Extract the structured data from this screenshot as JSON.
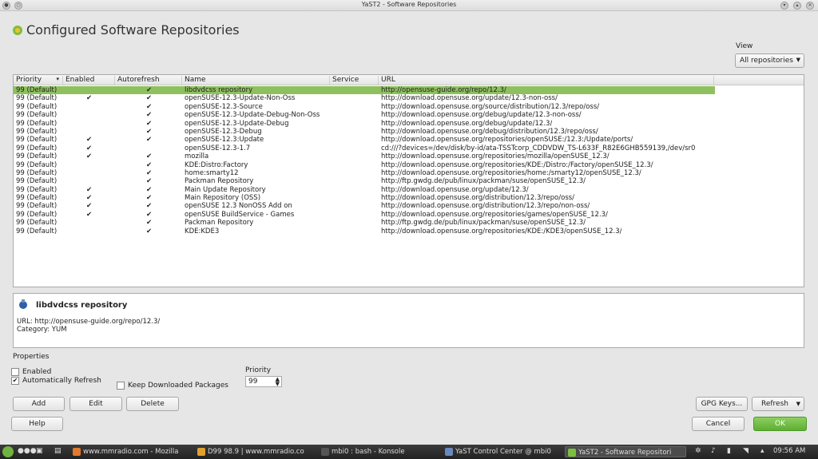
{
  "window": {
    "title": "YaST2 - Software Repositories"
  },
  "header": {
    "title": "Configured Software Repositories"
  },
  "view": {
    "label": "View",
    "selected": "All repositories"
  },
  "table": {
    "columns": [
      "Priority",
      "Enabled",
      "Autorefresh",
      "Name",
      "Service",
      "URL"
    ],
    "rows": [
      {
        "priority": "99 (Default)",
        "enabled": "",
        "autorefresh": "✔",
        "name": "libdvdcss repository",
        "service": "",
        "url": "http://opensuse-guide.org/repo/12.3/"
      },
      {
        "priority": "99 (Default)",
        "enabled": "✔",
        "autorefresh": "✔",
        "name": "openSUSE-12.3-Update-Non-Oss",
        "service": "",
        "url": "http://download.opensuse.org/update/12.3-non-oss/"
      },
      {
        "priority": "99 (Default)",
        "enabled": "",
        "autorefresh": "✔",
        "name": "openSUSE-12.3-Source",
        "service": "",
        "url": "http://download.opensuse.org/source/distribution/12.3/repo/oss/"
      },
      {
        "priority": "99 (Default)",
        "enabled": "",
        "autorefresh": "✔",
        "name": "openSUSE-12.3-Update-Debug-Non-Oss",
        "service": "",
        "url": "http://download.opensuse.org/debug/update/12.3-non-oss/"
      },
      {
        "priority": "99 (Default)",
        "enabled": "",
        "autorefresh": "✔",
        "name": "openSUSE-12.3-Update-Debug",
        "service": "",
        "url": "http://download.opensuse.org/debug/update/12.3/"
      },
      {
        "priority": "99 (Default)",
        "enabled": "",
        "autorefresh": "✔",
        "name": "openSUSE-12.3-Debug",
        "service": "",
        "url": "http://download.opensuse.org/debug/distribution/12.3/repo/oss/"
      },
      {
        "priority": "99 (Default)",
        "enabled": "✔",
        "autorefresh": "✔",
        "name": "openSUSE-12.3:Update",
        "service": "",
        "url": "http://download.opensuse.org/repositories/openSUSE:/12.3:/Update/ports/"
      },
      {
        "priority": "99 (Default)",
        "enabled": "✔",
        "autorefresh": "",
        "name": "openSUSE-12.3-1.7",
        "service": "",
        "url": "cd:///?devices=/dev/disk/by-id/ata-TSSTcorp_CDDVDW_TS-L633F_R82E6GHB559139,/dev/sr0"
      },
      {
        "priority": "99 (Default)",
        "enabled": "✔",
        "autorefresh": "✔",
        "name": "mozilla",
        "service": "",
        "url": "http://download.opensuse.org/repositories/mozilla/openSUSE_12.3/"
      },
      {
        "priority": "99 (Default)",
        "enabled": "",
        "autorefresh": "✔",
        "name": "KDE:Distro:Factory",
        "service": "",
        "url": "http://download.opensuse.org/repositories/KDE:/Distro:/Factory/openSUSE_12.3/"
      },
      {
        "priority": "99 (Default)",
        "enabled": "",
        "autorefresh": "✔",
        "name": "home:smarty12",
        "service": "",
        "url": "http://download.opensuse.org/repositories/home:/smarty12/openSUSE_12.3/"
      },
      {
        "priority": "99 (Default)",
        "enabled": "",
        "autorefresh": "✔",
        "name": "Packman Repository",
        "service": "",
        "url": "http://ftp.gwdg.de/pub/linux/packman/suse/openSUSE_12.3/"
      },
      {
        "priority": "99 (Default)",
        "enabled": "✔",
        "autorefresh": "✔",
        "name": "Main Update Repository",
        "service": "",
        "url": "http://download.opensuse.org/update/12.3/"
      },
      {
        "priority": "99 (Default)",
        "enabled": "✔",
        "autorefresh": "✔",
        "name": "Main Repository (OSS)",
        "service": "",
        "url": "http://download.opensuse.org/distribution/12.3/repo/oss/"
      },
      {
        "priority": "99 (Default)",
        "enabled": "✔",
        "autorefresh": "✔",
        "name": "openSUSE 12.3 NonOSS Add on",
        "service": "",
        "url": "http://download.opensuse.org/distribution/12.3/repo/non-oss/"
      },
      {
        "priority": "99 (Default)",
        "enabled": "✔",
        "autorefresh": "✔",
        "name": "openSUSE BuildService - Games",
        "service": "",
        "url": "http://download.opensuse.org/repositories/games/openSUSE_12.3/"
      },
      {
        "priority": "99 (Default)",
        "enabled": "",
        "autorefresh": "✔",
        "name": "Packman Repository",
        "service": "",
        "url": "http://ftp.gwdg.de/pub/linux/packman/suse/openSUSE_12.3/"
      },
      {
        "priority": "99 (Default)",
        "enabled": "",
        "autorefresh": "✔",
        "name": "KDE:KDE3",
        "service": "",
        "url": "http://download.opensuse.org/repositories/KDE:/KDE3/openSUSE_12.3/"
      }
    ]
  },
  "detail": {
    "title": "libdvdcss repository",
    "url": "URL: http://opensuse-guide.org/repo/12.3/",
    "category": "Category: YUM"
  },
  "properties": {
    "label": "Properties",
    "enabled_label": "Enabled",
    "autorefresh_label": "Automatically Refresh",
    "keep_label": "Keep Downloaded Packages",
    "priority_label": "Priority",
    "priority_value": "99"
  },
  "buttons": {
    "add": "Add",
    "edit": "Edit",
    "delete": "Delete",
    "gpg": "GPG Keys...",
    "refresh": "Refresh",
    "help": "Help",
    "cancel": "Cancel",
    "ok": "OK"
  },
  "taskbar": {
    "tasks": [
      "www.mmradio.com - Mozilla",
      "D99 98.9 | www.mmradio.co",
      "mbi0 : bash - Konsole",
      "YaST Control Center @ mbi0",
      "YaST2 - Software Repositori"
    ],
    "clock": "09:56 AM"
  },
  "colors": {
    "selection": "#8ec15e",
    "ok": "#5fae35"
  }
}
